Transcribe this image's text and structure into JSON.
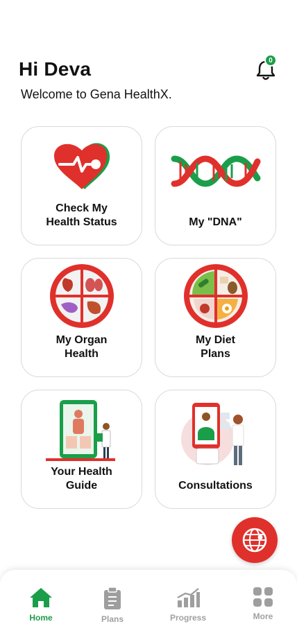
{
  "header": {
    "greeting": "Hi Deva",
    "welcome": "Welcome to Gena HealthX.",
    "notification_count": "0"
  },
  "cards": [
    {
      "label": "Check My\nHealth Status",
      "icon": "heart-pulse-icon"
    },
    {
      "label": "My \"DNA\"",
      "icon": "dna-icon"
    },
    {
      "label": "My Organ\nHealth",
      "icon": "organs-plate-icon"
    },
    {
      "label": "My Diet\nPlans",
      "icon": "diet-plate-icon"
    },
    {
      "label": "Your Health\nGuide",
      "icon": "doctor-screen-icon"
    },
    {
      "label": "Consultations",
      "icon": "consultation-icon"
    }
  ],
  "fab": {
    "icon": "radar-globe-icon"
  },
  "nav": {
    "items": [
      {
        "label": "Home",
        "icon": "home-icon",
        "active": true
      },
      {
        "label": "Plans",
        "icon": "clipboard-icon",
        "active": false
      },
      {
        "label": "Progress",
        "icon": "bar-chart-icon",
        "active": false
      },
      {
        "label": "More",
        "icon": "grid-icon",
        "active": false
      }
    ]
  },
  "colors": {
    "accent_red": "#e0302b",
    "accent_green": "#1a9e4a"
  }
}
